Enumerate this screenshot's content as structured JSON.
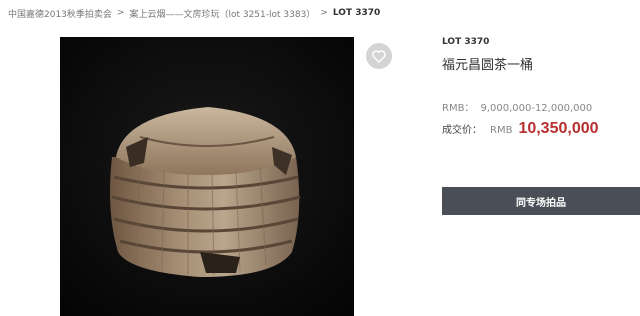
{
  "breadcrumb": {
    "items": [
      "中国嘉德2013秋季拍卖会",
      "案上云烟——文房珍玩（lot 3251-lot 3383）"
    ],
    "current": "LOT 3370",
    "separator": ">"
  },
  "lot": {
    "number": "LOT 3370",
    "title": "福元昌圆茶一桶"
  },
  "estimate": {
    "currency_label": "RMB：",
    "range": "9,000,000-12,000,000"
  },
  "sold": {
    "label": "成交价：",
    "currency": "RMB",
    "price": "10,350,000"
  },
  "actions": {
    "same_session_button": "同专场拍品"
  },
  "icons": {
    "favorite": "heart-outline-icon"
  },
  "colors": {
    "price": "#b83030",
    "button_bg": "#4a4f57",
    "fav_bg": "#d4d4d4",
    "photo_bg": "#0b0b0b"
  }
}
